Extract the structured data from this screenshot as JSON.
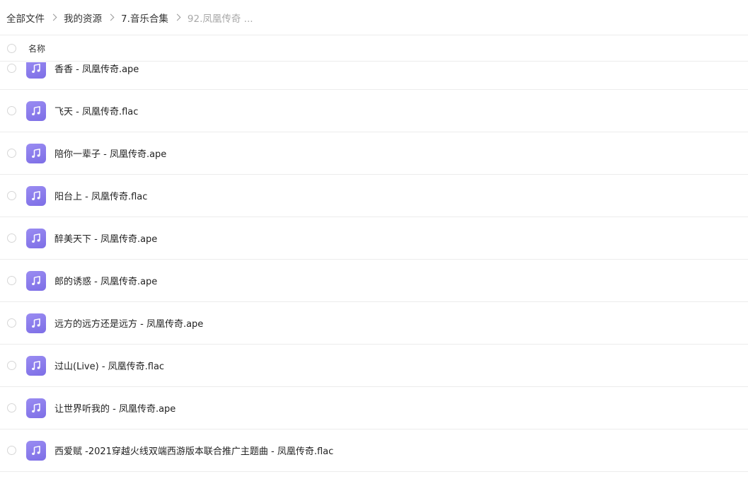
{
  "breadcrumb": {
    "items": [
      "全部文件",
      "我的资源",
      "7.音乐合集"
    ],
    "current": "92.凤凰传奇 ..."
  },
  "header": {
    "name_label": "名称"
  },
  "files": [
    {
      "name": "香香 - 凤凰传奇.ape",
      "icon": "music-file-icon",
      "color": "#8878ec"
    },
    {
      "name": "飞天 - 凤凰传奇.flac",
      "icon": "music-file-icon",
      "color": "#8878ec"
    },
    {
      "name": "陪你一辈子 - 凤凰传奇.ape",
      "icon": "music-file-icon",
      "color": "#8878ec"
    },
    {
      "name": "阳台上 - 凤凰传奇.flac",
      "icon": "music-file-icon",
      "color": "#8878ec"
    },
    {
      "name": "醉美天下 - 凤凰传奇.ape",
      "icon": "music-file-icon",
      "color": "#8878ec"
    },
    {
      "name": "郎的诱惑 - 凤凰传奇.ape",
      "icon": "music-file-icon",
      "color": "#8878ec"
    },
    {
      "name": "远方的远方还是远方 - 凤凰传奇.ape",
      "icon": "music-file-icon",
      "color": "#8878ec"
    },
    {
      "name": "过山(Live) - 凤凰传奇.flac",
      "icon": "music-file-icon",
      "color": "#8878ec"
    },
    {
      "name": "让世界听我的 - 凤凰传奇.ape",
      "icon": "music-file-icon",
      "color": "#8878ec"
    },
    {
      "name": "西爱赋 -2021穿越火线双端西游版本联合推广主题曲 - 凤凰传奇.flac",
      "icon": "music-file-icon",
      "color": "#8878ec"
    }
  ]
}
